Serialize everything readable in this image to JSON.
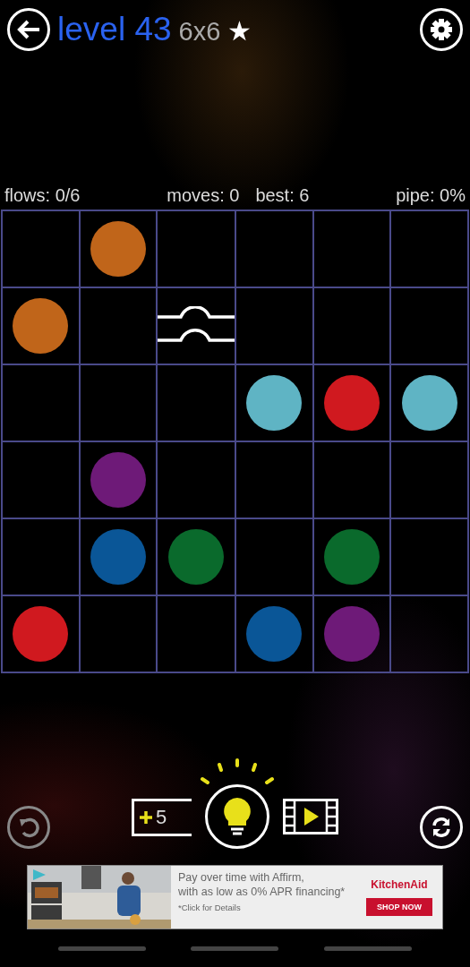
{
  "header": {
    "level": "level 43",
    "size": "6x6",
    "star": "★"
  },
  "stats": {
    "flows": "flows: 0/6",
    "moves": "moves: 0",
    "best": "best: 6",
    "pipe": "pipe: 0%"
  },
  "grid": [
    [
      {
        "kind": "empty"
      },
      {
        "kind": "dot",
        "color": "#c0651a"
      },
      {
        "kind": "empty"
      },
      {
        "kind": "empty"
      },
      {
        "kind": "empty"
      },
      {
        "kind": "empty"
      }
    ],
    [
      {
        "kind": "dot",
        "color": "#c0651a"
      },
      {
        "kind": "empty"
      },
      {
        "kind": "bridge"
      },
      {
        "kind": "empty"
      },
      {
        "kind": "empty"
      },
      {
        "kind": "empty"
      }
    ],
    [
      {
        "kind": "empty"
      },
      {
        "kind": "empty"
      },
      {
        "kind": "empty"
      },
      {
        "kind": "dot",
        "color": "#5fb4c4"
      },
      {
        "kind": "dot",
        "color": "#d0191f"
      },
      {
        "kind": "dot",
        "color": "#5fb4c4"
      }
    ],
    [
      {
        "kind": "empty"
      },
      {
        "kind": "dot",
        "color": "#6e1a78"
      },
      {
        "kind": "empty"
      },
      {
        "kind": "empty"
      },
      {
        "kind": "empty"
      },
      {
        "kind": "empty"
      }
    ],
    [
      {
        "kind": "empty"
      },
      {
        "kind": "dot",
        "color": "#0a5697"
      },
      {
        "kind": "dot",
        "color": "#0a6a2c"
      },
      {
        "kind": "empty"
      },
      {
        "kind": "dot",
        "color": "#0a6a2c"
      },
      {
        "kind": "empty"
      }
    ],
    [
      {
        "kind": "dot",
        "color": "#d0191f"
      },
      {
        "kind": "empty"
      },
      {
        "kind": "empty"
      },
      {
        "kind": "dot",
        "color": "#0a5697"
      },
      {
        "kind": "dot",
        "color": "#6e1a78"
      },
      {
        "kind": "empty"
      }
    ]
  ],
  "controls": {
    "hint_count": "5"
  },
  "ad": {
    "line1": "Pay over time with Affirm,",
    "line2": "with as low as 0% APR financing*",
    "note": "*Click for Details",
    "brand": "KitchenAid",
    "button": "SHOP NOW"
  }
}
